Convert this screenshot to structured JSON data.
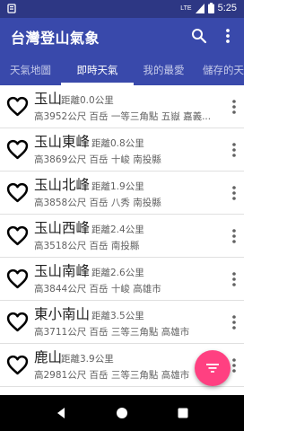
{
  "status_bar": {
    "network": "LTE",
    "time": "5:25"
  },
  "app_bar": {
    "title": "台灣登山氣象",
    "actions": [
      "search-icon",
      "more-vert-icon"
    ]
  },
  "tabs": [
    {
      "label": "天氣地圖",
      "active": false
    },
    {
      "label": "即時天氣",
      "active": true
    },
    {
      "label": "我的最愛",
      "active": false
    },
    {
      "label": "儲存的天氣",
      "active": false
    }
  ],
  "mountains": [
    {
      "name": "玉山",
      "distance": "距離0.0公里",
      "info": "高3952公尺 百岳 一等三角點 五嶽 嘉義...",
      "favorite": false
    },
    {
      "name": "玉山東峰",
      "distance": "距離0.8公里",
      "info": "高3869公尺 百岳 十峻 南投縣",
      "favorite": false
    },
    {
      "name": "玉山北峰",
      "distance": "距離1.9公里",
      "info": "高3858公尺 百岳 八秀 南投縣",
      "favorite": false
    },
    {
      "name": "玉山西峰",
      "distance": "距離2.4公里",
      "info": "高3518公尺 百岳 南投縣",
      "favorite": false
    },
    {
      "name": "玉山南峰",
      "distance": "距離2.6公里",
      "info": "高3844公尺 百岳 十峻 高雄市",
      "favorite": false
    },
    {
      "name": "東小南山",
      "distance": "距離3.5公里",
      "info": "高3711公尺 百岳 三等三角點 高雄市",
      "favorite": false
    },
    {
      "name": "鹿山",
      "distance": "距離3.9公里",
      "info": "高2981公尺 百岳 三等三角點 高雄市",
      "favorite": false
    }
  ],
  "fab": {
    "icon": "filter-icon"
  },
  "colors": {
    "primary": "#3949ab",
    "status_bar": "#2d3784",
    "accent": "#ff4081"
  }
}
